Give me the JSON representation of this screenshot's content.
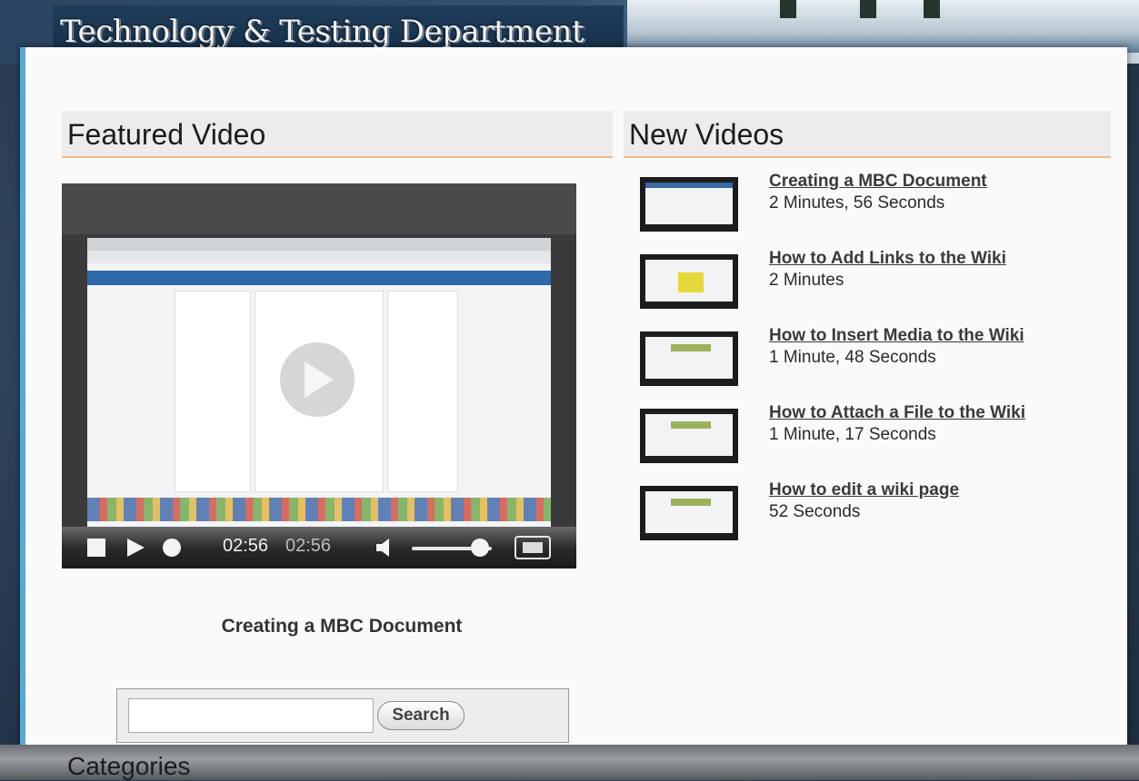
{
  "banner": {
    "title": "Technology & Testing Department"
  },
  "featured": {
    "heading": "Featured Video",
    "caption": "Creating a MBC Document",
    "player": {
      "time_current": "02:56",
      "time_total": "02:56",
      "volume_level": 0.85
    }
  },
  "new_videos": {
    "heading": "New Videos",
    "items": [
      {
        "title": "Creating a MBC Document",
        "duration": "2 Minutes, 56 Seconds"
      },
      {
        "title": "How to Add Links to the Wiki",
        "duration": "2 Minutes"
      },
      {
        "title": "How to Insert Media to the Wiki",
        "duration": "1 Minute, 48 Seconds"
      },
      {
        "title": "How to Attach a File to the Wiki",
        "duration": "1 Minute, 17 Seconds"
      },
      {
        "title": "How to edit a wiki page",
        "duration": "52 Seconds"
      }
    ]
  },
  "search": {
    "value": "",
    "button_label": "Search"
  },
  "categories": {
    "heading": "Categories"
  },
  "colors": {
    "accent_border": "#f1b98a",
    "panel_left_border": "#5aa7d6",
    "banner_title_bg": "#163047"
  }
}
